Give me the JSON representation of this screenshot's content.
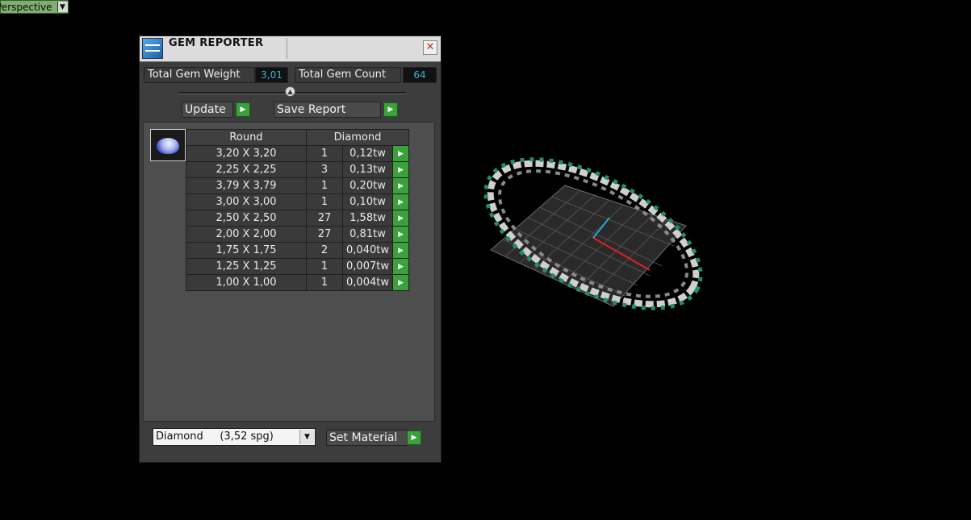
{
  "viewport": {
    "label": "Perspective"
  },
  "panel": {
    "title": "GEM REPORTER",
    "close_label": "✕",
    "total_weight_label": "Total Gem Weight",
    "total_weight_value": "3,01",
    "total_count_label": "Total Gem Count",
    "total_count_value": "64",
    "update_label": "Update",
    "save_report_label": "Save Report",
    "table": {
      "header_shape": "Round",
      "header_material": "Diamond",
      "rows": [
        {
          "size": "3,20 X 3,20",
          "qty": "1",
          "weight": "0,12tw"
        },
        {
          "size": "2,25 X 2,25",
          "qty": "3",
          "weight": "0,13tw"
        },
        {
          "size": "3,79 X 3,79",
          "qty": "1",
          "weight": "0,20tw"
        },
        {
          "size": "3,00 X 3,00",
          "qty": "1",
          "weight": "0,10tw"
        },
        {
          "size": "2,50 X 2,50",
          "qty": "27",
          "weight": "1,58tw"
        },
        {
          "size": "2,00 X 2,00",
          "qty": "27",
          "weight": "0,81tw"
        },
        {
          "size": "1,75 X 1,75",
          "qty": "2",
          "weight": "0,040tw"
        },
        {
          "size": "1,25 X 1,25",
          "qty": "1",
          "weight": "0,007tw"
        },
        {
          "size": "1,00 X 1,00",
          "qty": "1",
          "weight": "0,004tw"
        }
      ]
    },
    "material_select": "Diamond     (3,52 spg)",
    "set_material_label": "Set Material"
  }
}
